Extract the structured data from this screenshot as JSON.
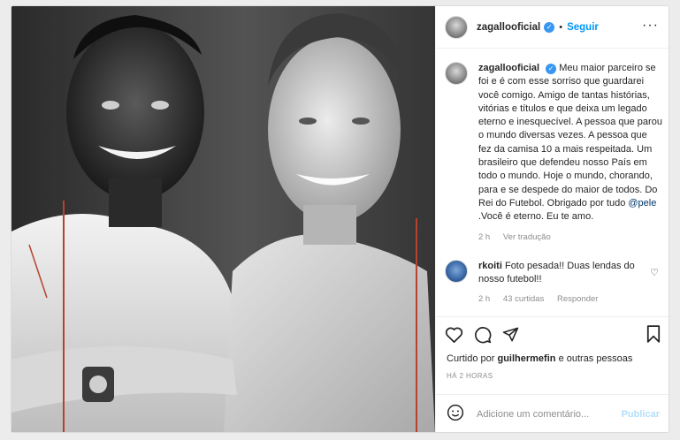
{
  "post": {
    "username": "zagallooficial",
    "verified": true,
    "separator": "•",
    "follow_label": "Seguir",
    "more_icon": "more-horizontal-icon"
  },
  "caption": {
    "username": "zagallooficial",
    "text_before_mention": "Meu maior parceiro se foi e é com esse sorriso que guardarei você comigo. Amigo de tantas histórias, vitórias e títulos e que deixa um legado eterno e inesquecível. A pessoa que parou o mundo diversas vezes. A pessoa que fez da camisa 10 a mais respeitada. Um brasileiro que defendeu nosso País em todo o mundo. Hoje o mundo, chorando, para e se despede do maior de todos. Do Rei do Futebol. Obrigado por tudo ",
    "mention": "@pele",
    "text_after_mention": " .Você é eterno. Eu te amo.",
    "age": "2 h",
    "translate_label": "Ver tradução"
  },
  "comment": {
    "username": "rkoiti",
    "text": "Foto pesada!! Duas lendas do nosso futebol!!",
    "age": "2 h",
    "likes": "43 curtidas",
    "reply_label": "Responder"
  },
  "likes": {
    "prefix": "Curtido por",
    "user": "guilhermefin",
    "suffix": "e outras pessoas"
  },
  "timestamp": "HÁ 2 HORAS",
  "add_comment": {
    "placeholder": "Adicione um comentário...",
    "publish_label": "Publicar"
  },
  "colors": {
    "accent": "#0095f6",
    "verified": "#3897f0",
    "publish_disabled": "#b2dffc",
    "muted": "#8e8e8e"
  }
}
